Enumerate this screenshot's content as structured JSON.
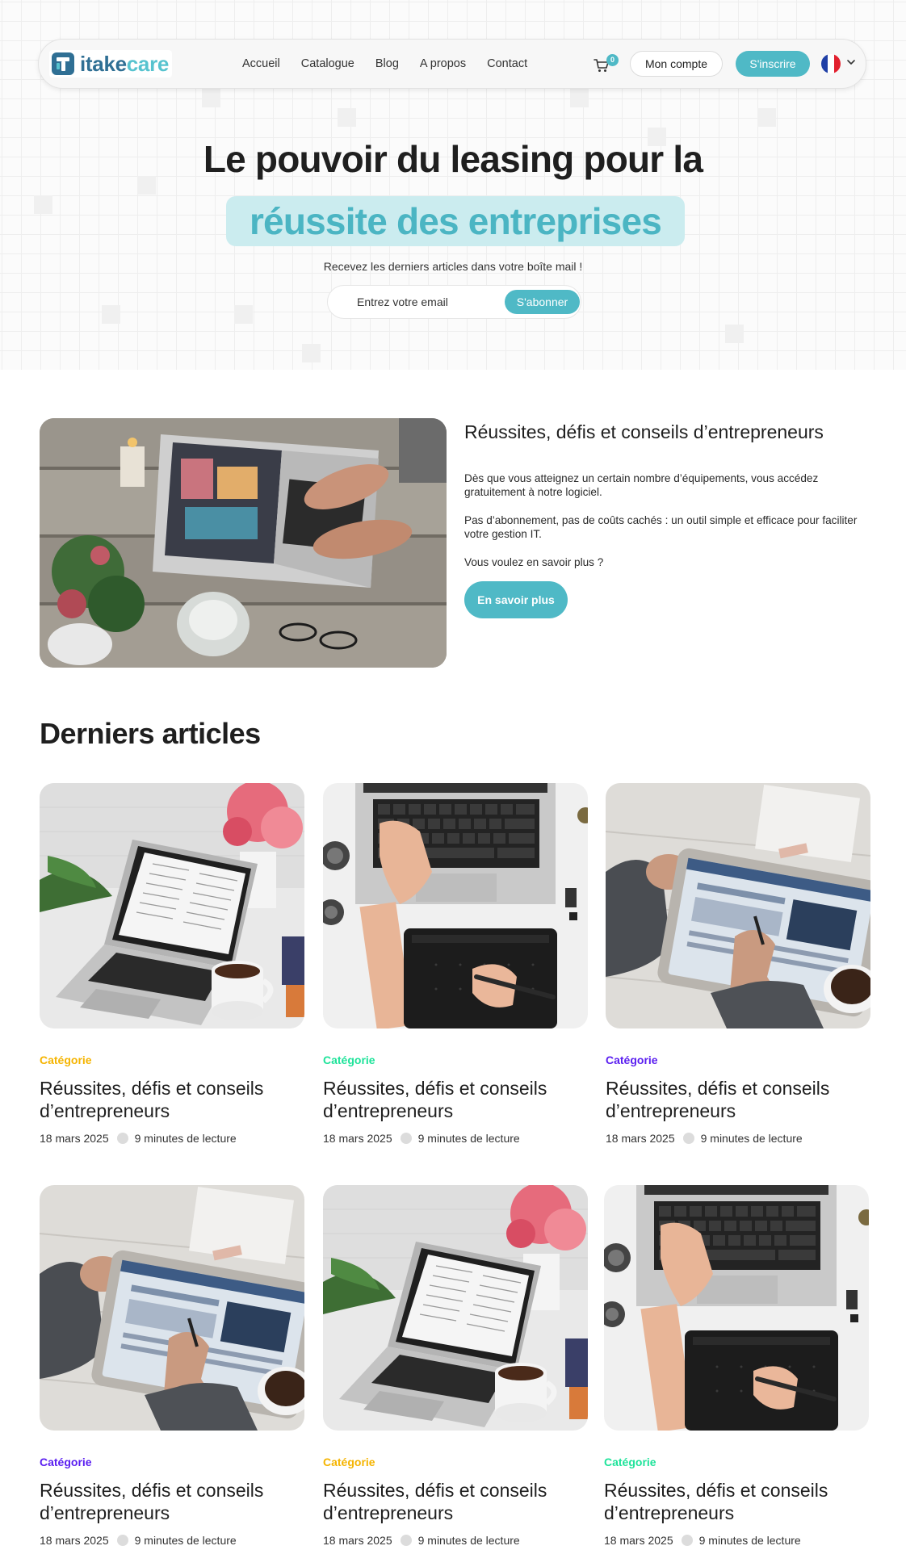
{
  "colors": {
    "accent": "#4fb9c6",
    "highlight_bg": "#cbecef",
    "logo_dark": "#2f6f94",
    "cat_yellow": "#f5b400",
    "cat_green": "#1ee39a",
    "cat_purple": "#5a1ef0"
  },
  "nav": {
    "logo_part1": "itake",
    "logo_part2": "care",
    "links": [
      "Accueil",
      "Catalogue",
      "Blog",
      "A propos",
      "Contact"
    ],
    "cart_icon": "cart-icon",
    "cart_count": "0",
    "account_label": "Mon compte",
    "signup_label": "S'inscrire",
    "language_icon": "france-flag-icon"
  },
  "hero": {
    "title_line1": "Le pouvoir du leasing pour la",
    "title_line2": "réussite des entreprises",
    "subtitle": "Recevez les derniers articles dans votre boîte mail !",
    "email_placeholder": "Entrez votre email",
    "subscribe_label": "S'abonner"
  },
  "feature": {
    "title": "Réussites, défis et conseils d’entrepreneurs",
    "paragraphs": [
      "Dès que vous atteignez un certain nombre d’équipements, vous accédez gratuitement à notre logiciel.",
      "Pas d’abonnement, pas de coûts cachés : un outil simple et efficace pour faciliter votre gestion IT.",
      "Vous voulez en savoir plus ?"
    ],
    "button_label": "En savoir plus"
  },
  "articles": {
    "section_title": "Derniers articles",
    "items": [
      {
        "category": "Catégorie",
        "category_color": "#f5b400",
        "title": "Réussites, défis et conseils d’entrepreneurs",
        "date": "18 mars 2025",
        "read_time": "9 minutes de lecture",
        "image": "laptop-coffee"
      },
      {
        "category": "Catégorie",
        "category_color": "#1ee39a",
        "title": "Réussites, défis et conseils d’entrepreneurs",
        "date": "18 mars 2025",
        "read_time": "9 minutes de lecture",
        "image": "keyboard-tablet"
      },
      {
        "category": "Catégorie",
        "category_color": "#5a1ef0",
        "title": "Réussites, défis et conseils d’entrepreneurs",
        "date": "18 mars 2025",
        "read_time": "9 minutes de lecture",
        "image": "tablet-pen"
      },
      {
        "category": "Catégorie",
        "category_color": "#5a1ef0",
        "title": "Réussites, défis et conseils d’entrepreneurs",
        "date": "18 mars 2025",
        "read_time": "9 minutes de lecture",
        "image": "tablet-pen"
      },
      {
        "category": "Catégorie",
        "category_color": "#f5b400",
        "title": "Réussites, défis et conseils d’entrepreneurs",
        "date": "18 mars 2025",
        "read_time": "9 minutes de lecture",
        "image": "laptop-coffee"
      },
      {
        "category": "Catégorie",
        "category_color": "#1ee39a",
        "title": "Réussites, défis et conseils d’entrepreneurs",
        "date": "18 mars 2025",
        "read_time": "9 minutes de lecture",
        "image": "keyboard-tablet"
      }
    ]
  }
}
